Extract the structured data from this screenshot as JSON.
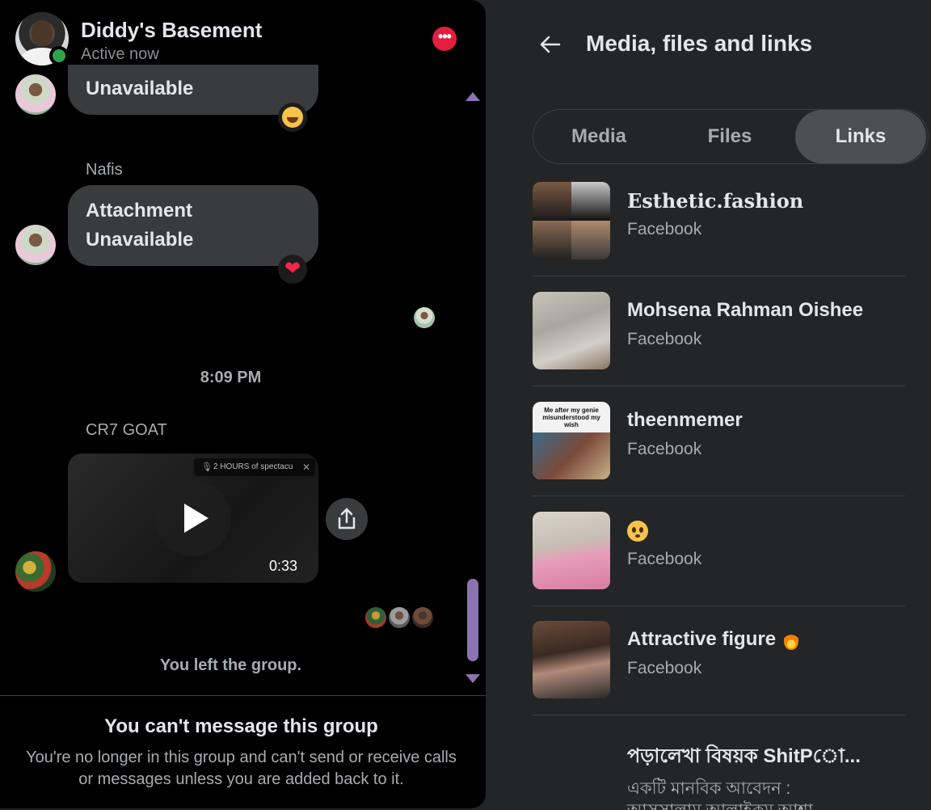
{
  "chat": {
    "group_name": "Diddy's Basement",
    "status": "Active now",
    "messages": {
      "first_bubble": "Unavailable",
      "second_sender": "Nafis",
      "second_line1": "Attachment",
      "second_line2": "Unavailable",
      "timestamp": "8:09 PM",
      "third_sender": "CR7 GOAT",
      "video_title": "2 HOURS of spectacu",
      "video_duration": "0:33",
      "left_notice": "You left the group."
    },
    "footer": {
      "title": "You can't message this group",
      "description": "You're no longer in this group and can't send or receive calls or messages unless you are added back to it."
    }
  },
  "side": {
    "title": "Media, files and links",
    "tabs": [
      "Media",
      "Files",
      "Links"
    ],
    "active_tab": "Links",
    "links": [
      {
        "title": "Esthetic.fashion",
        "source": "Facebook"
      },
      {
        "title": "Mohsena Rahman Oishee",
        "source": "Facebook"
      },
      {
        "title": "theenmemer",
        "source": "Facebook"
      },
      {
        "title": "",
        "source": "Facebook"
      },
      {
        "title": "Attractive figure",
        "source": "Facebook"
      },
      {
        "title": "পড়ালেখা বিষয়ক ShitPো...",
        "source": "একটি মানবিক আবেদন :"
      }
    ],
    "meme_caption": "Me after my genie misunderstood my wish",
    "last_line2": "আসসালাম আলাইকুম আশা"
  },
  "colors": {
    "accent": "#8b74b0",
    "online": "#31a24c",
    "danger": "#e41e3f",
    "panel": "#242526",
    "bubble": "#3a3b3c"
  },
  "icons": [
    "back-arrow-icon",
    "more-options-icon",
    "play-icon",
    "share-icon",
    "laugh-emoji-icon",
    "heart-emoji-icon",
    "pleading-face-emoji-icon",
    "fire-emoji-icon"
  ]
}
